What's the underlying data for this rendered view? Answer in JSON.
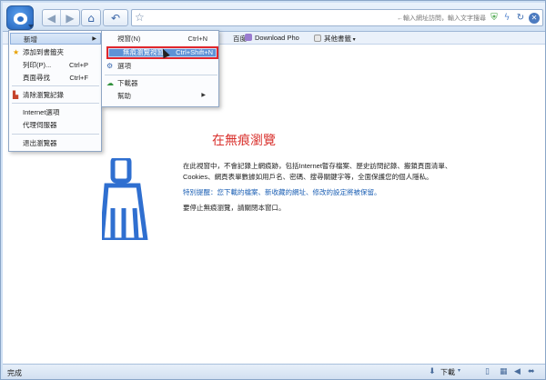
{
  "toolbar": {
    "address_placeholder": "←輸入網址訪問，輸入文字搜尋"
  },
  "bookmarks": {
    "items": [
      {
        "label": "百度"
      },
      {
        "label": "Download Pho"
      },
      {
        "label": "其他書籤"
      }
    ]
  },
  "main_menu": {
    "items": [
      {
        "label": "新增",
        "shortcut": ""
      },
      {
        "label": "添加到書籤夾",
        "shortcut": ""
      },
      {
        "label": "列印(P)...",
        "shortcut": "Ctrl+P"
      },
      {
        "label": "頁面尋找",
        "shortcut": "Ctrl+F"
      },
      {
        "label": "清除瀏覽記錄",
        "shortcut": ""
      },
      {
        "label": "Internet選項",
        "shortcut": ""
      },
      {
        "label": "代理伺服器",
        "shortcut": ""
      },
      {
        "label": "退出瀏覽器",
        "shortcut": ""
      }
    ]
  },
  "sub_menu": {
    "items": [
      {
        "label": "視窗(N)",
        "shortcut": "Ctrl+N"
      },
      {
        "label": "無痕瀏覽視窗",
        "shortcut": "Ctrl+Shift+N"
      },
      {
        "label": "選項",
        "shortcut": ""
      },
      {
        "label": "下載器",
        "shortcut": ""
      },
      {
        "label": "幫助",
        "shortcut": ""
      }
    ]
  },
  "content": {
    "title": "在無痕瀏覽",
    "p1": "在此視窗中，不會記錄上網痕跡，包括Internet暫存檔案、歷史訪問記錄、搬鎖頁面清單、Cookies、網頁表單數據如用戶名、密碼、搜尋關鍵字等，全面保護您的個人隱私。",
    "p2": "特別提醒：您下載的檔案、新收藏的網址、修改的設定將被保留。",
    "p3": "要停止無痕瀏覽，請關閉本窗口。"
  },
  "statusbar": {
    "status": "完成",
    "download": "下載"
  },
  "colors": {
    "accent": "#3a6fc0",
    "highlight_border": "#e0262c",
    "title_red": "#d9322e"
  }
}
